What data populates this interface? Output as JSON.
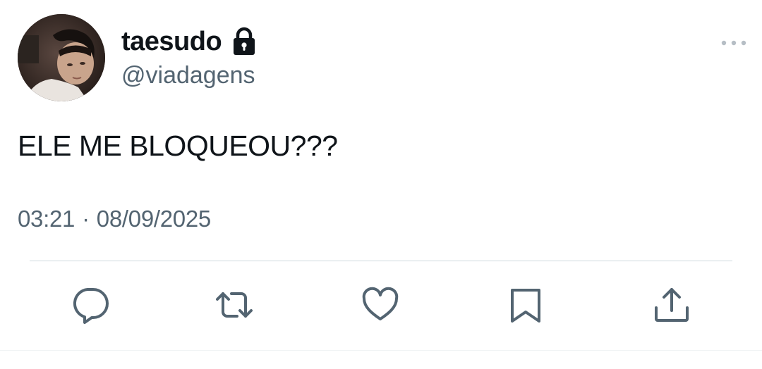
{
  "author": {
    "display_name": "taesudo",
    "handle": "@viadagens",
    "protected": true,
    "avatar_icon": "avatar-photo"
  },
  "tweet": {
    "text": "ELE ME BLOQUEOU???",
    "time": "03:21",
    "separator": "·",
    "date": "08/09/2025"
  },
  "icons": {
    "lock": "lock-icon",
    "more": "more-icon",
    "reply": "reply-icon",
    "retweet": "retweet-icon",
    "like": "like-icon",
    "bookmark": "bookmark-icon",
    "share": "share-icon"
  },
  "colors": {
    "text_primary": "#0f1419",
    "text_secondary": "#536471",
    "icon_gray": "#536471",
    "divider": "#cfd9de",
    "background": "#ffffff"
  }
}
